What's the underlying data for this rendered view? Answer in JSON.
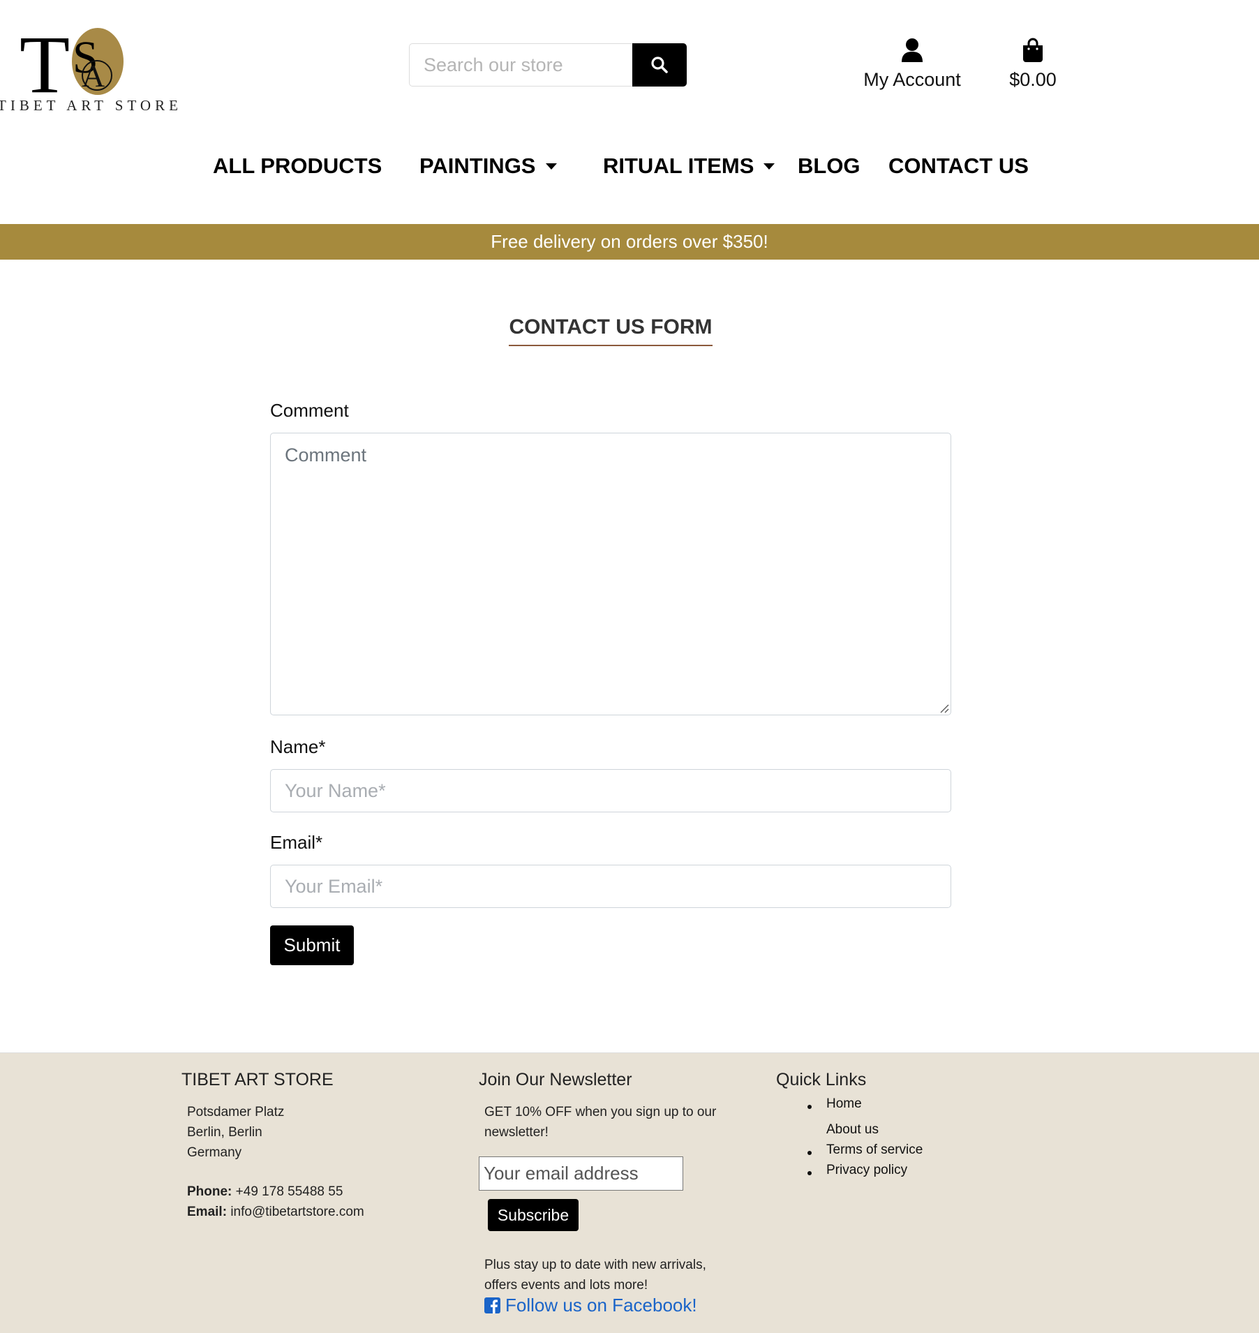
{
  "header": {
    "logo_monogram": "TAS",
    "logo_wordmark": "TIBET ART STORE",
    "search_placeholder": "Search our store",
    "account_label": "My Account",
    "cart_total": "$0.00"
  },
  "nav": {
    "items": [
      {
        "label": "ALL PRODUCTS",
        "has_dropdown": false
      },
      {
        "label": "PAINTINGS",
        "has_dropdown": true
      },
      {
        "label": "RITUAL ITEMS",
        "has_dropdown": true
      },
      {
        "label": "BLOG",
        "has_dropdown": false
      },
      {
        "label": "CONTACT US",
        "has_dropdown": false
      }
    ]
  },
  "banner": {
    "text": "Free delivery on orders over $350!"
  },
  "form": {
    "title": "CONTACT US FORM",
    "comment_label": "Comment",
    "comment_placeholder": "Comment",
    "name_label": "Name*",
    "name_placeholder": "Your Name*",
    "email_label": "Email*",
    "email_placeholder": "Your Email*",
    "submit_label": "Submit"
  },
  "footer": {
    "store": {
      "heading": "TIBET ART STORE",
      "address": [
        "Potsdamer Platz",
        "Berlin, Berlin",
        "Germany"
      ],
      "phone_label": "Phone:",
      "phone": "+49 178 55488 55",
      "email_label": "Email:",
      "email": "info@tibetartstore.com"
    },
    "newsletter": {
      "heading": "Join Our Newsletter",
      "intro_line1": "GET 10% OFF when you sign up to our",
      "intro_line2": "newsletter!",
      "email_placeholder": "Your email address",
      "subscribe_label": "Subscribe",
      "outro_line1": "Plus stay up to date with new arrivals,",
      "outro_line2": "offers events and lots more!",
      "facebook_label": "Follow us on Facebook!"
    },
    "quick_links": {
      "heading": "Quick Links",
      "items": [
        "Home",
        "About us",
        "Terms of service",
        "Privacy policy"
      ]
    }
  },
  "colors": {
    "banner": "#a68a3d",
    "footer_bg": "#e8e2d6",
    "logo_gold": "#a88a47",
    "facebook_link": "#1a64c8",
    "title_underline": "#8b5a3c"
  },
  "icons": {
    "search": "search-icon",
    "account": "user-icon",
    "cart": "shopping-bag-icon",
    "facebook": "facebook-square-icon",
    "dropdown": "caret-down-icon"
  }
}
